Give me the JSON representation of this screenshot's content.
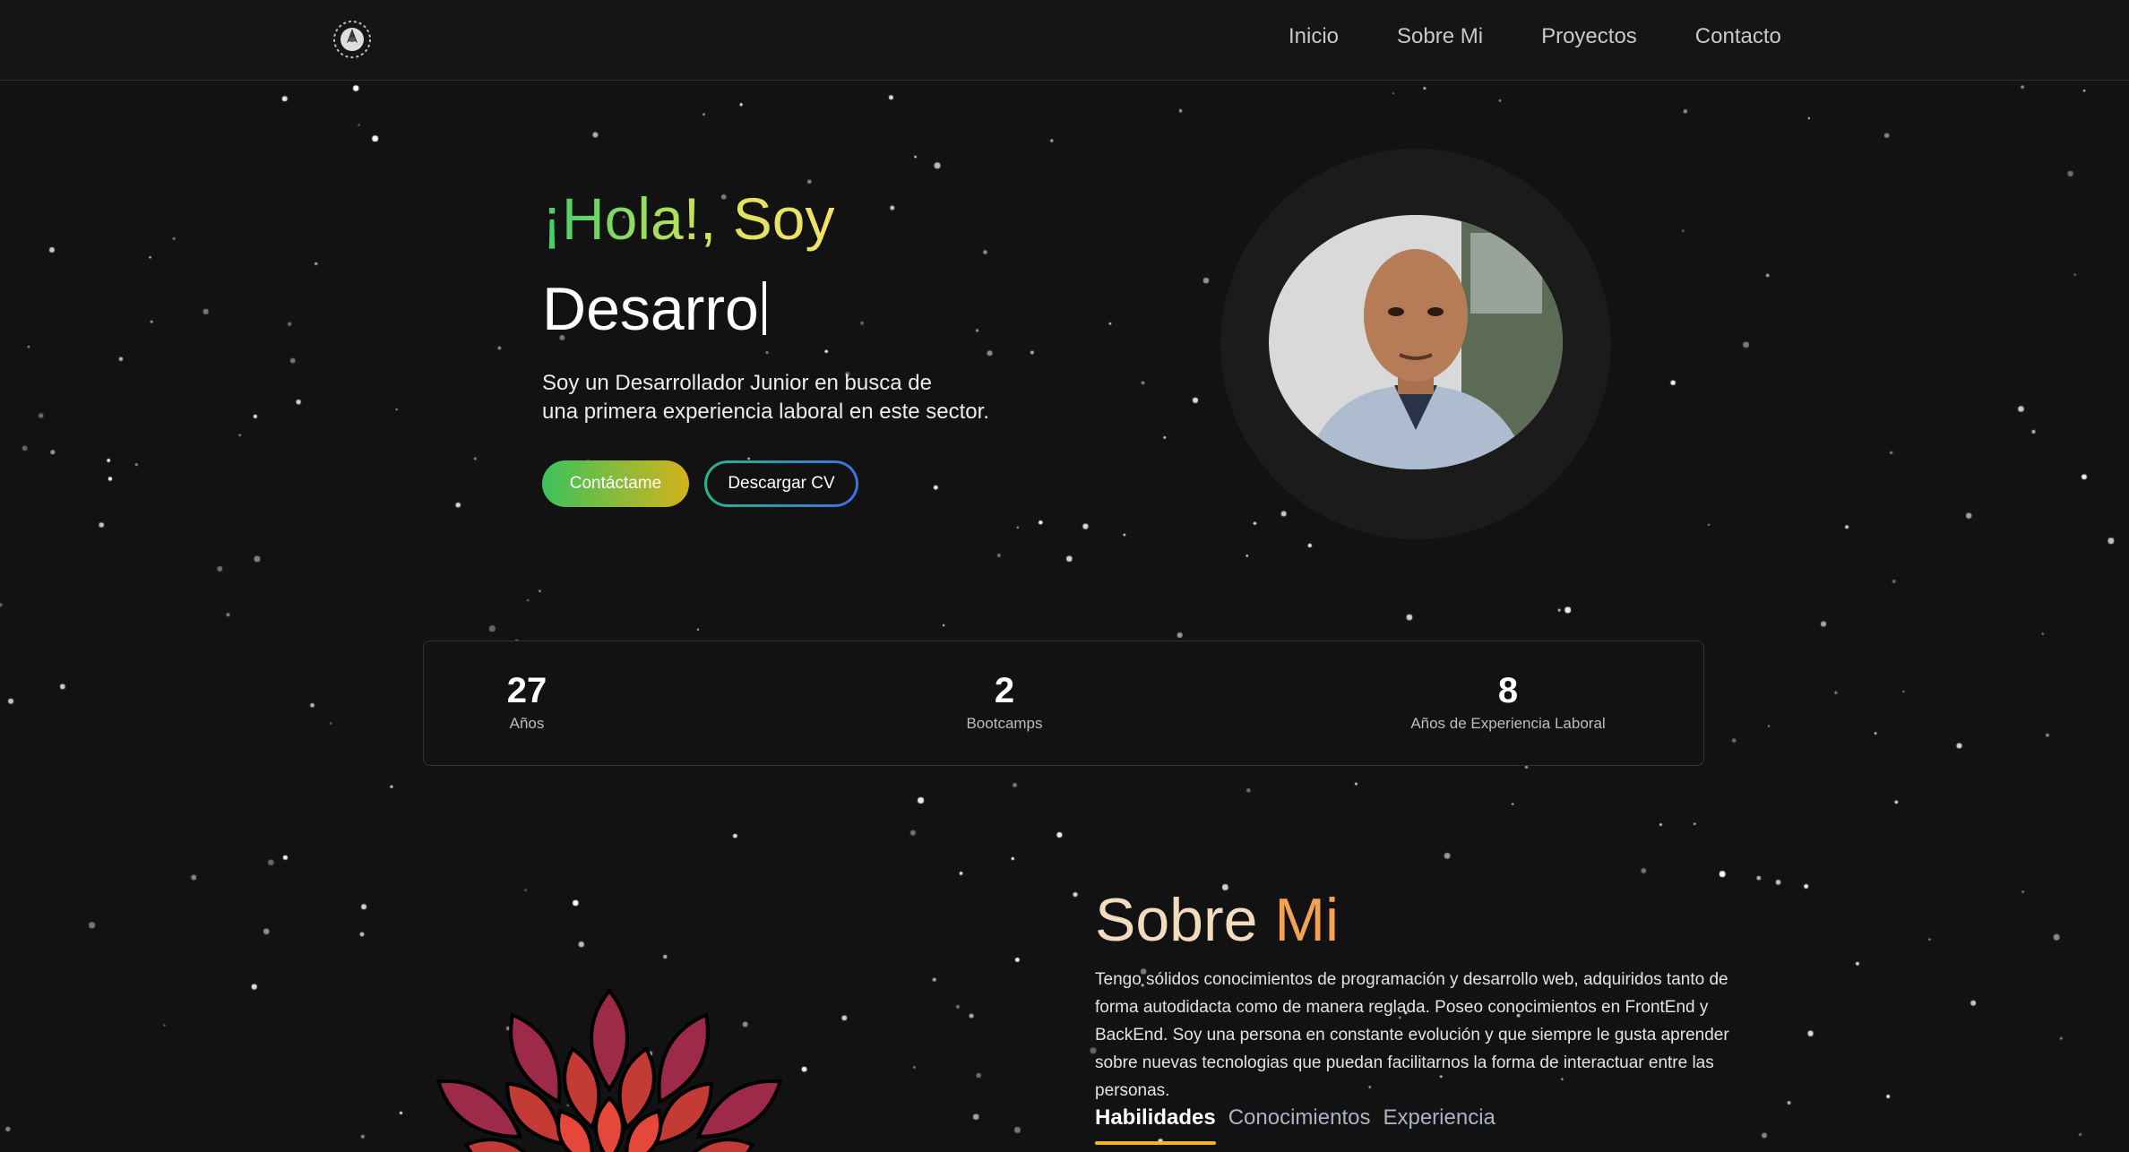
{
  "nav": {
    "logo_icon": "mandala-logo-icon",
    "links": [
      {
        "label": "Inicio"
      },
      {
        "label": "Sobre Mi"
      },
      {
        "label": "Proyectos"
      },
      {
        "label": "Contacto"
      }
    ]
  },
  "hero": {
    "greeting": "¡Hola!, Soy",
    "typed_text": "Desarro",
    "description_line1": "Soy un Desarrollador Junior en busca de",
    "description_line2": "una primera experiencia laboral en este sector.",
    "contact_button": "Contáctame",
    "cv_button": "Descargar CV",
    "photo_icon": "profile-photo"
  },
  "stats": [
    {
      "value": "27",
      "label": "Años"
    },
    {
      "value": "2",
      "label": "Bootcamps"
    },
    {
      "value": "8",
      "label": "Años de Experiencia Laboral"
    }
  ],
  "about": {
    "title_part1": "Sobre",
    "title_part2": "Mi",
    "text": "Tengo sólidos conocimientos de programación y desarrollo web, adquiridos tanto de forma autodidacta como de manera reglada. Poseo conocimientos en FrontEnd y BackEnd. Soy una persona en constante evolución y que siempre le gusta aprender sobre nuevas tecnologias que puedan facilitarnos la forma de interactuar entre las personas.",
    "tabs": [
      {
        "label": "Habilidades",
        "active": true
      },
      {
        "label": "Conocimientos",
        "active": false
      },
      {
        "label": "Experiencia",
        "active": false
      }
    ]
  },
  "colors": {
    "background": "#121212",
    "greeting_gradient": [
      "#3fcf6b",
      "#f5e06a"
    ],
    "about_accent": "#f2a257",
    "tab_underline": "#f2b42a"
  }
}
